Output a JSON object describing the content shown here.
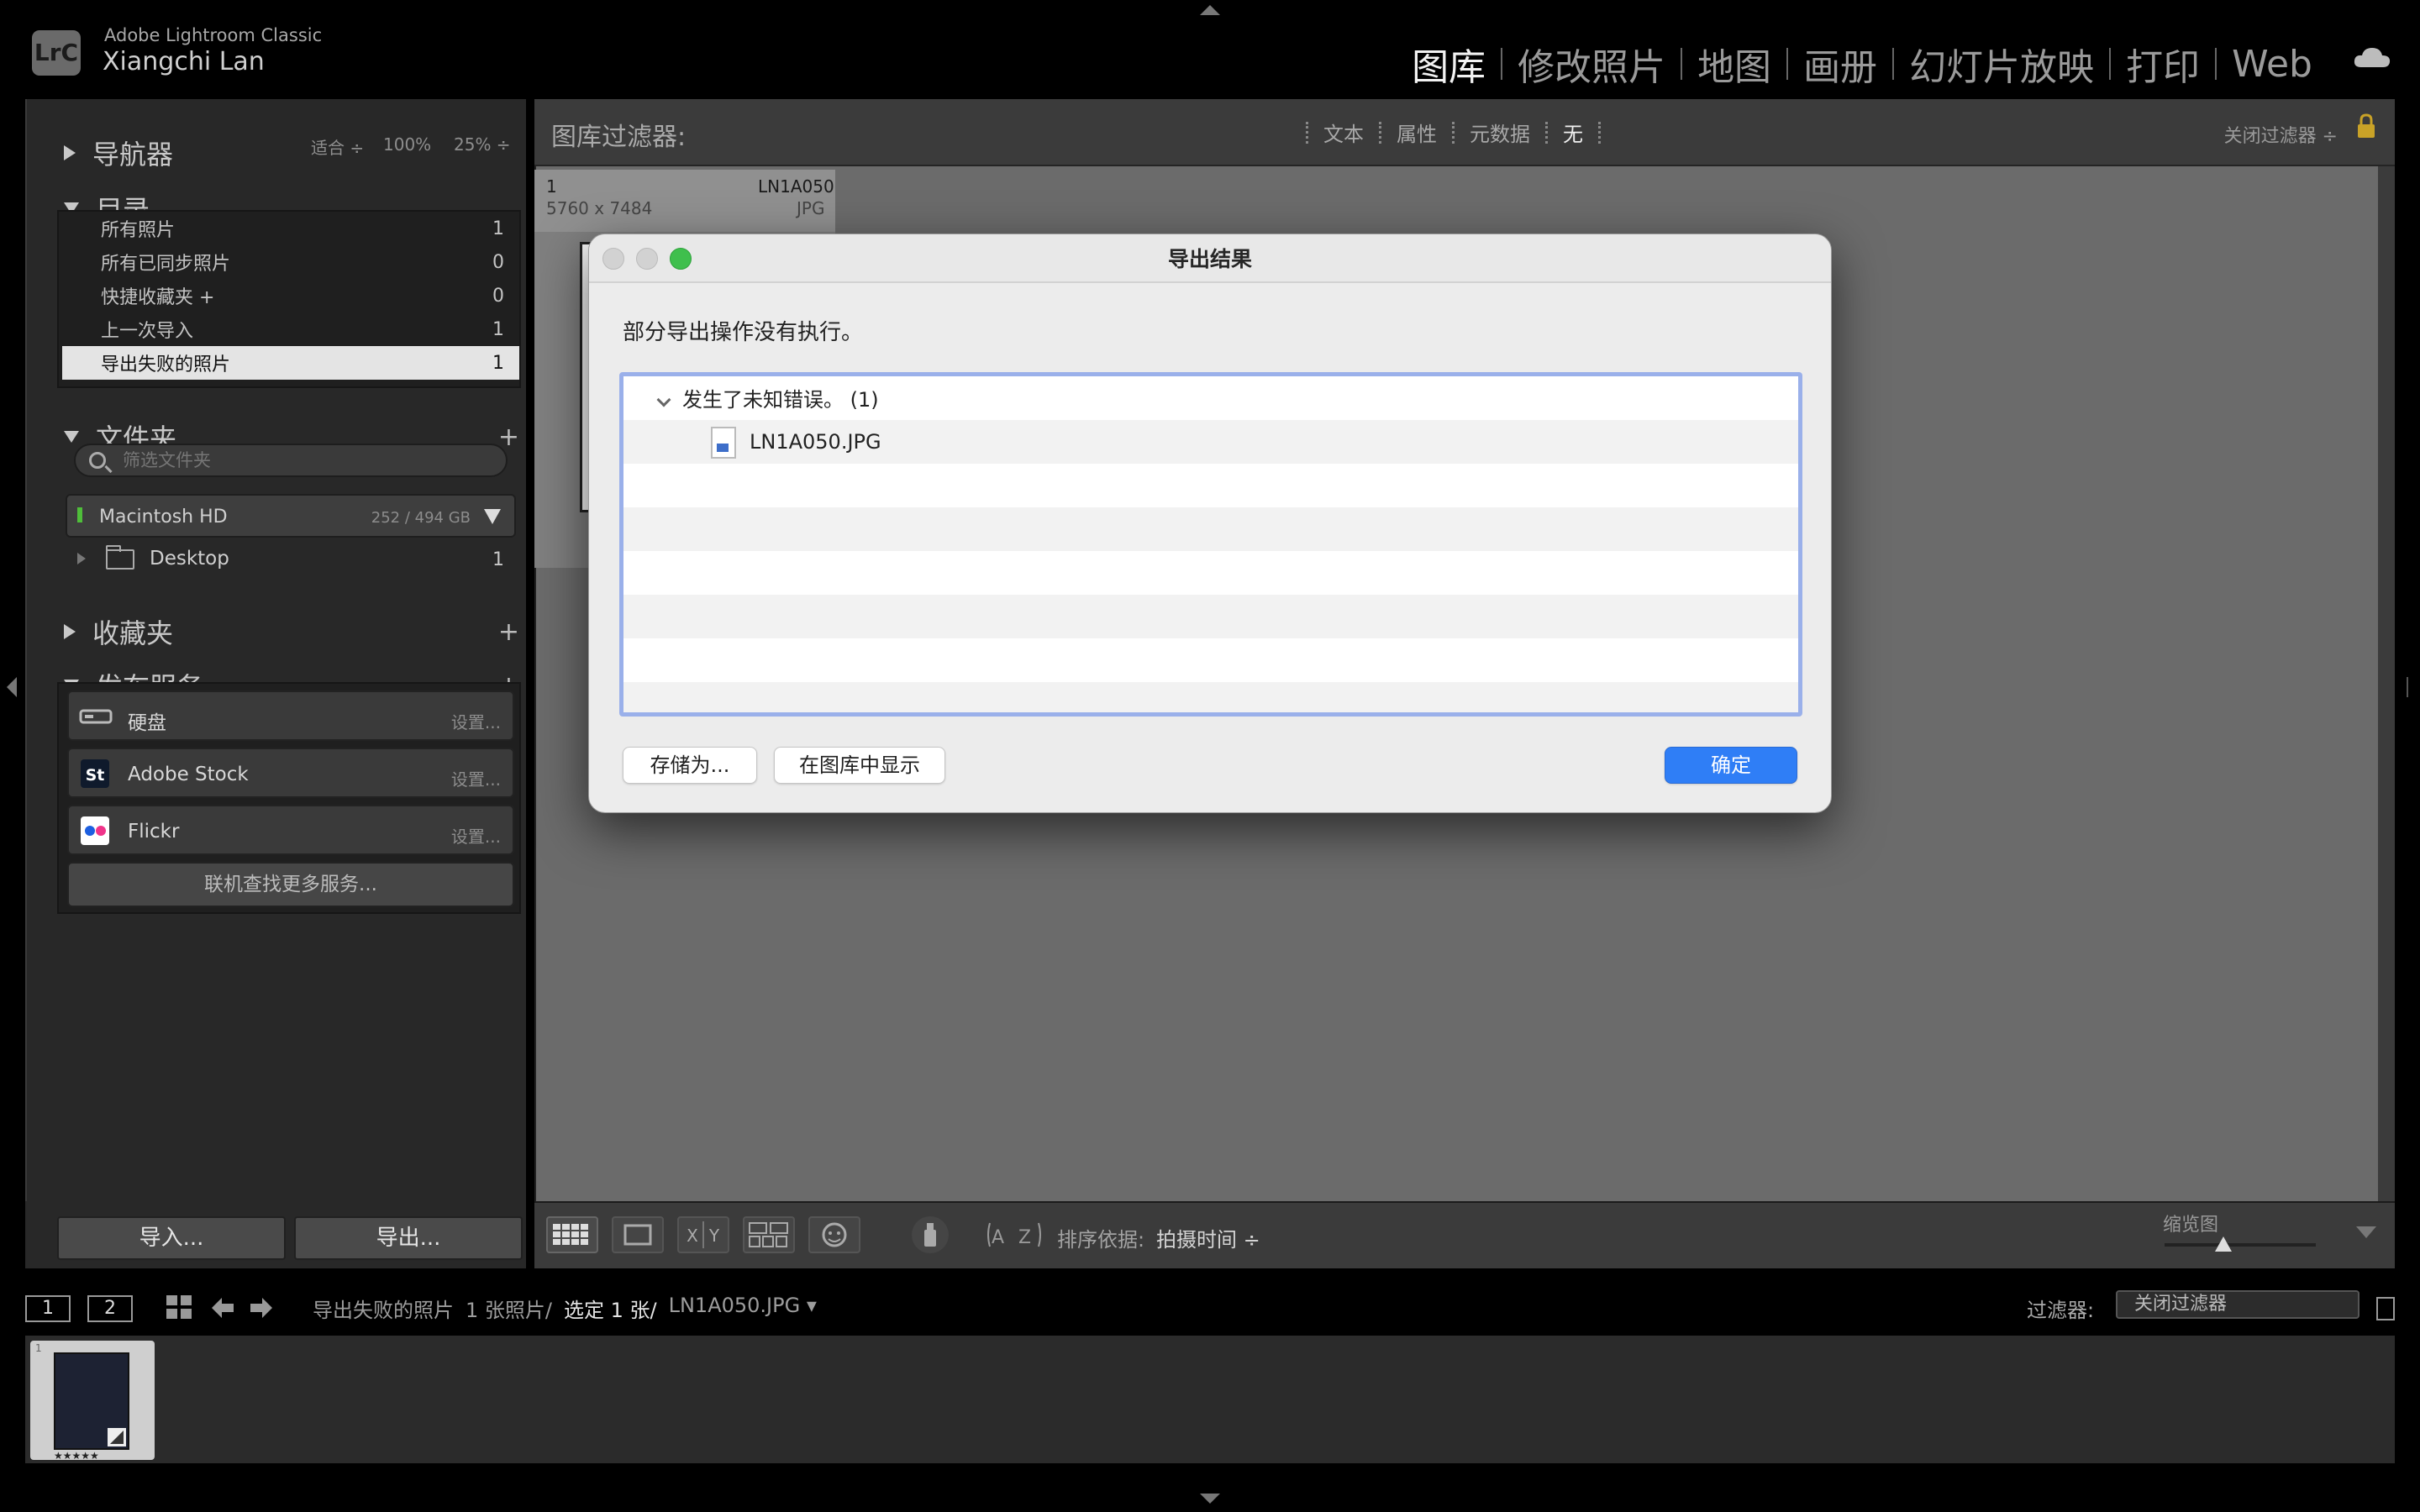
{
  "app": {
    "logo": "LrC",
    "subtitle": "Adobe Lightroom Classic",
    "user": "Xiangchi Lan"
  },
  "modules": [
    "图库",
    "修改照片",
    "地图",
    "画册",
    "幻灯片放映",
    "打印",
    "Web"
  ],
  "active_module": "图库",
  "navigator": {
    "title": "导航器",
    "opts": [
      "适合 ÷",
      "100%",
      "25% ÷"
    ]
  },
  "catalog": {
    "title": "目录",
    "items": [
      {
        "label": "所有照片",
        "count": "1"
      },
      {
        "label": "所有已同步照片",
        "count": "0"
      },
      {
        "label": "快捷收藏夹 +",
        "count": "0"
      },
      {
        "label": "上一次导入",
        "count": "1"
      },
      {
        "label": "导出失败的照片",
        "count": "1"
      }
    ]
  },
  "folders": {
    "title": "文件夹",
    "search_placeholder": "筛选文件夹",
    "volume": {
      "name": "Macintosh HD",
      "size": "252 / 494 GB"
    },
    "folder": {
      "name": "Desktop",
      "count": "1"
    }
  },
  "collections": {
    "title": "收藏夹"
  },
  "publish": {
    "title": "发布服务",
    "services": [
      {
        "name": "硬盘",
        "setup": "设置..."
      },
      {
        "name": "Adobe Stock",
        "setup": "设置..."
      },
      {
        "name": "Flickr",
        "setup": "设置..."
      }
    ],
    "find_more": "联机查找更多服务..."
  },
  "left_buttons": {
    "import": "导入...",
    "export": "导出..."
  },
  "filter_bar": {
    "title": "图库过滤器:",
    "options": [
      "文本",
      "属性",
      "元数据",
      "无"
    ],
    "active": "无",
    "close": "关闭过滤器 ÷"
  },
  "grid_cell": {
    "index": "1",
    "dimensions": "5760 x 7484",
    "name": "LN1A050",
    "type": "JPG"
  },
  "toolbar": {
    "sort_label": "排序依据:",
    "sort_value": "拍摄时间 ÷",
    "thumb_label": "缩览图"
  },
  "filmstrip_bar": {
    "pages": [
      "1",
      "2"
    ],
    "source": "导出失败的照片",
    "count": "1 张照片/",
    "selected": "选定 1 张/",
    "file": "LN1A050.JPG ▾",
    "filter_label": "过滤器:",
    "filter_value": "关闭过滤器"
  },
  "filmstrip": {
    "index": "1",
    "stars": "★★★★★"
  },
  "dialog": {
    "title": "导出结果",
    "message": "部分导出操作没有执行。",
    "group": "发生了未知错误。 (1)",
    "file": "LN1A050.JPG",
    "save_as": "存储为...",
    "show_in_library": "在图库中显示",
    "ok": "确定"
  },
  "colors": {
    "accent_blue": "#2f7ef6",
    "close_light": "#d0d0d0",
    "zoom_light": "#3fbf4d",
    "tree_border": "#9ab0ea"
  }
}
